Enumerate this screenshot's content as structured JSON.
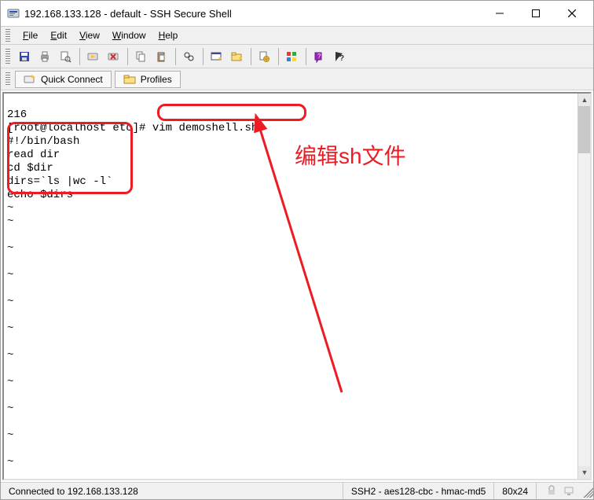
{
  "titlebar": {
    "title": "192.168.133.128 - default - SSH Secure Shell"
  },
  "menubar": {
    "file": "File",
    "edit": "Edit",
    "view": "View",
    "window": "Window",
    "help": "Help"
  },
  "quickbar": {
    "quick_connect": "Quick Connect",
    "profiles": "Profiles"
  },
  "terminal": {
    "line1": "216",
    "prompt": "[root@localhost etc]#",
    "command": " vim demoshell.sh",
    "script_l1": "#!/bin/bash",
    "script_l2": "read dir",
    "script_l3": "cd $dir",
    "script_l4": "dirs=`ls |wc -l`",
    "script_l5": "echo $dirs",
    "tilde": "~"
  },
  "statusbar": {
    "connected": "Connected to 192.168.133.128",
    "cipher": "SSH2 - aes128-cbc - hmac-md5",
    "size": "80x24"
  },
  "annotation": {
    "label": "编辑sh文件"
  }
}
